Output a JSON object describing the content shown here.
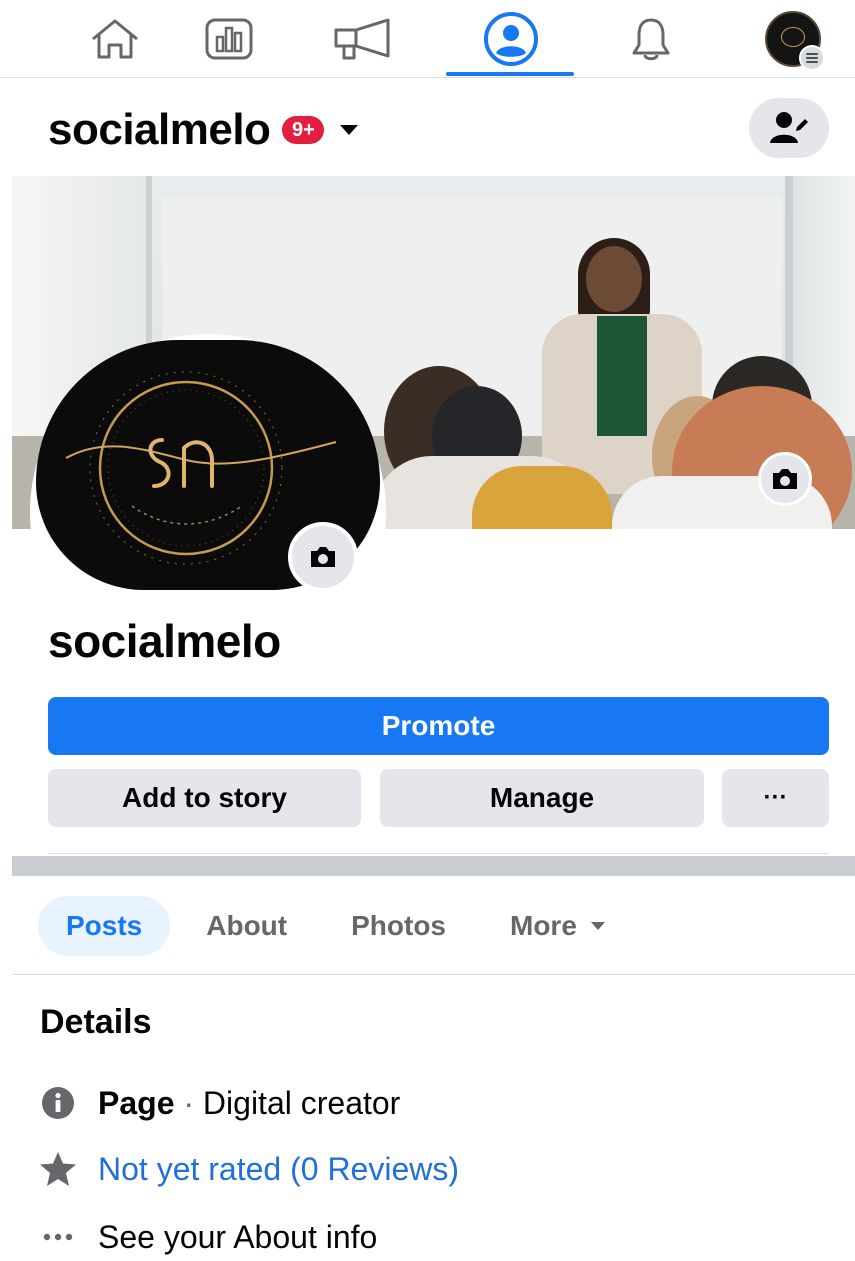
{
  "nav": {
    "items": [
      {
        "name": "home",
        "icon": "home-icon"
      },
      {
        "name": "insights",
        "icon": "bar-chart-icon"
      },
      {
        "name": "ads",
        "icon": "megaphone-icon"
      },
      {
        "name": "profile",
        "icon": "profile-icon",
        "active": true
      },
      {
        "name": "notifications",
        "icon": "bell-icon"
      },
      {
        "name": "account-menu",
        "icon": "avatar"
      }
    ],
    "accent_color": "#1877f2"
  },
  "header": {
    "page_name": "socialmelo",
    "notification_badge": "9+"
  },
  "profile": {
    "name": "socialmelo"
  },
  "actions": {
    "promote": "Promote",
    "add_to_story": "Add to story",
    "manage": "Manage",
    "more": "···"
  },
  "tabs": [
    {
      "label": "Posts",
      "active": true
    },
    {
      "label": "About"
    },
    {
      "label": "Photos"
    },
    {
      "label": "More"
    }
  ],
  "details": {
    "title": "Details",
    "page_type_label": "Page",
    "separator": "·",
    "page_type_value": "Digital creator",
    "rating": "Not yet rated (0 Reviews)",
    "about": "See your About info"
  },
  "colors": {
    "primary": "#1877f2",
    "badge": "#e41e3f",
    "link": "#216fdb",
    "button_gray": "#e4e6eb"
  }
}
